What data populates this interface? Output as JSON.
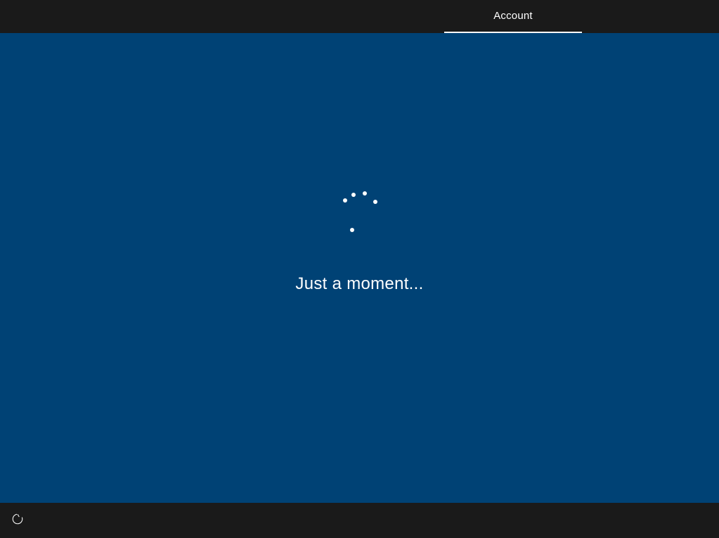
{
  "topbar": {
    "active_tab_label": "Account"
  },
  "loading": {
    "message": "Just a moment..."
  },
  "bottombar": {
    "ease_of_access_icon": "ease-of-access-icon"
  },
  "colors": {
    "background": "#004275",
    "bar": "#1a1a1a",
    "text": "#ffffff"
  }
}
